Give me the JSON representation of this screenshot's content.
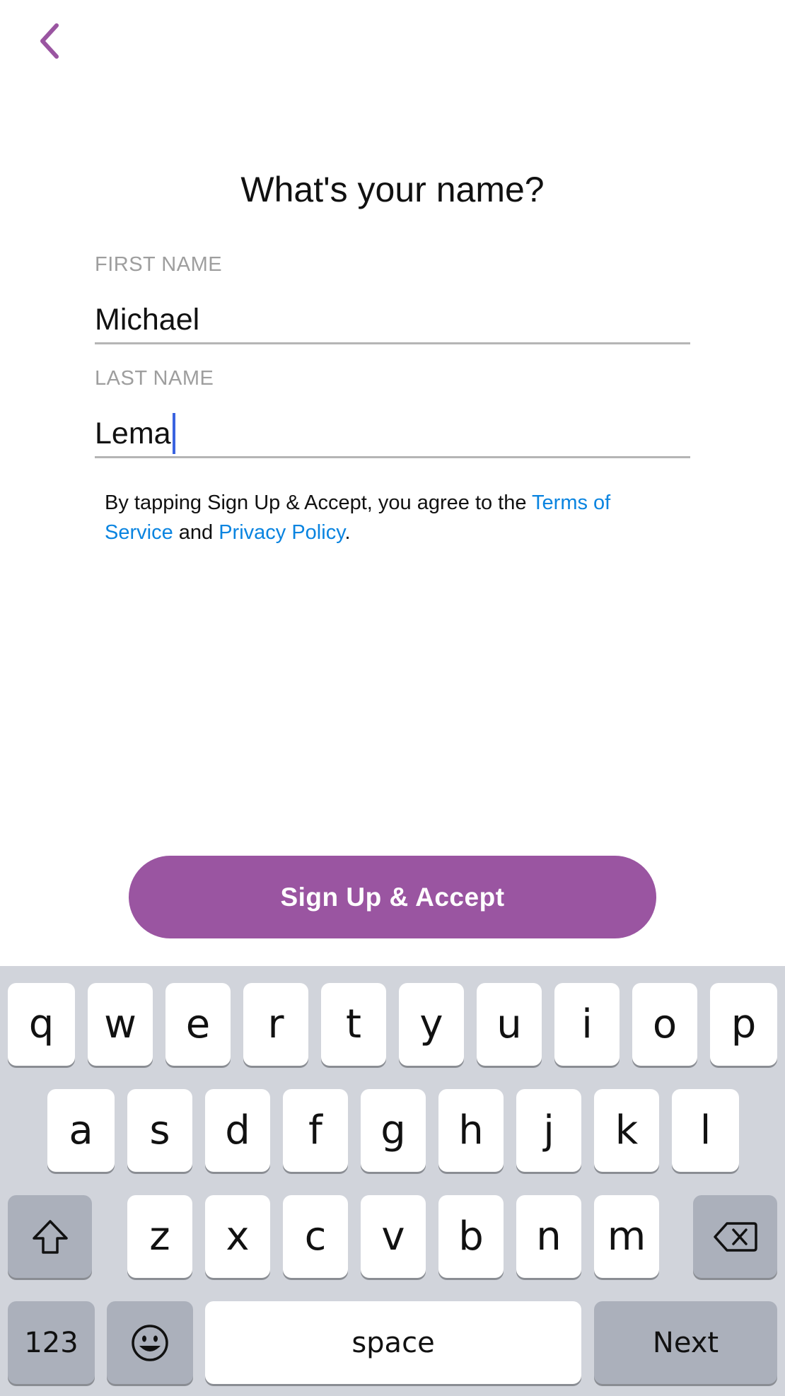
{
  "header": {
    "back_icon": "chevron-left-icon",
    "accent_color": "#9a55a1"
  },
  "title": "What's your name?",
  "first_name": {
    "label": "FIRST NAME",
    "value": "Michael"
  },
  "last_name": {
    "label": "LAST NAME",
    "value": "Lema"
  },
  "legal": {
    "prefix": "By tapping Sign Up & Accept, you agree to the ",
    "terms_link": "Terms of Service",
    "middle": " and ",
    "privacy_link": "Privacy Policy",
    "suffix": ".",
    "link_color": "#0a84e0"
  },
  "signup_button": {
    "label": "Sign Up & Accept",
    "color": "#9a55a1"
  },
  "keyboard": {
    "row1": [
      "q",
      "w",
      "e",
      "r",
      "t",
      "y",
      "u",
      "i",
      "o",
      "p"
    ],
    "row2": [
      "a",
      "s",
      "d",
      "f",
      "g",
      "h",
      "j",
      "k",
      "l"
    ],
    "row3": [
      "z",
      "x",
      "c",
      "v",
      "b",
      "n",
      "m"
    ],
    "shift_icon": "shift-icon",
    "delete_icon": "backspace-icon",
    "numbers_label": "123",
    "emoji_icon": "emoji-icon",
    "space_label": "space",
    "return_label": "Next"
  }
}
